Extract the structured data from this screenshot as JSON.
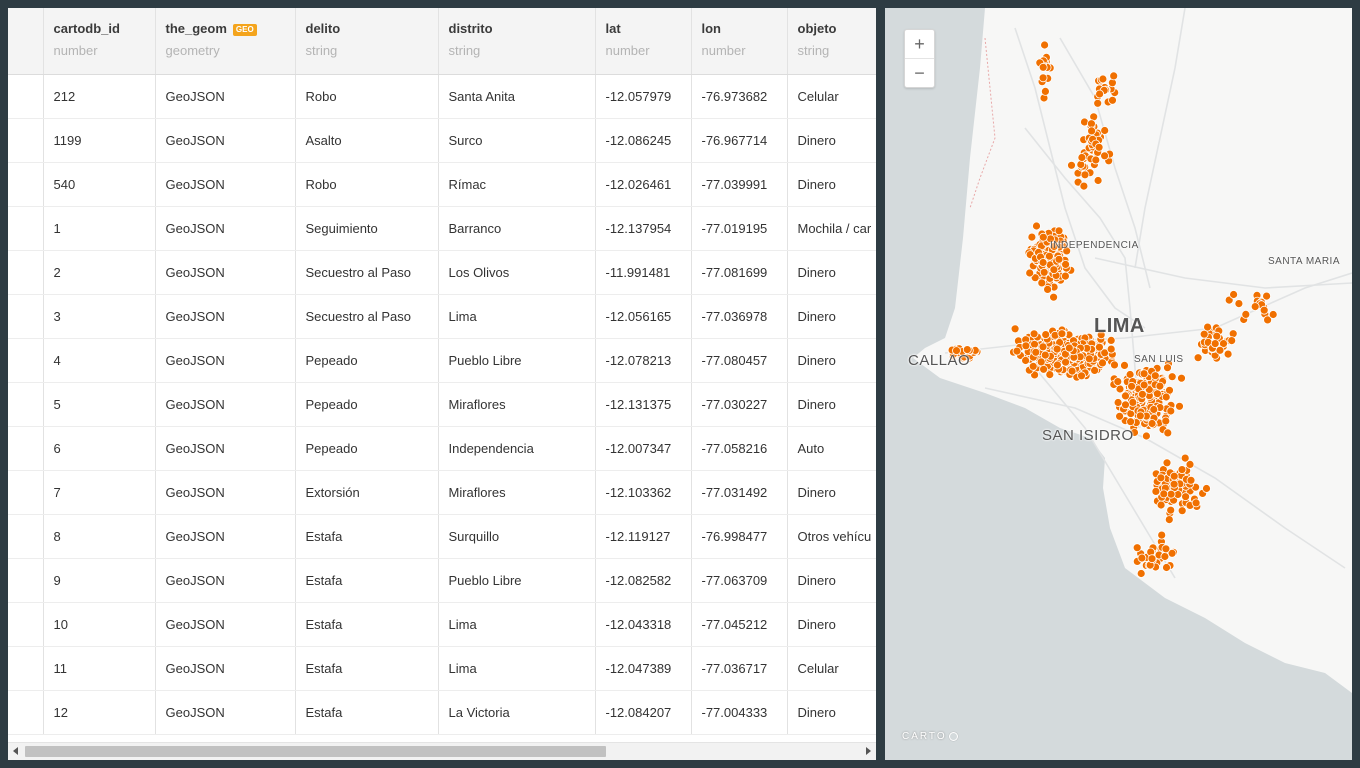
{
  "table": {
    "columns": [
      {
        "name": "cartodb_id",
        "type": "number"
      },
      {
        "name": "the_geom",
        "type": "geometry",
        "badge": "GEO"
      },
      {
        "name": "delito",
        "type": "string"
      },
      {
        "name": "distrito",
        "type": "string"
      },
      {
        "name": "lat",
        "type": "number"
      },
      {
        "name": "lon",
        "type": "number"
      },
      {
        "name": "objeto",
        "type": "string"
      }
    ],
    "rows": [
      {
        "id": "212",
        "geom": "GeoJSON",
        "delito": "Robo",
        "distrito": "Santa Anita",
        "lat": "-12.057979",
        "lon": "-76.973682",
        "objeto": "Celular"
      },
      {
        "id": "1199",
        "geom": "GeoJSON",
        "delito": "Asalto",
        "distrito": "Surco",
        "lat": "-12.086245",
        "lon": "-76.967714",
        "objeto": "Dinero"
      },
      {
        "id": "540",
        "geom": "GeoJSON",
        "delito": "Robo",
        "distrito": "Rímac",
        "lat": "-12.026461",
        "lon": "-77.039991",
        "objeto": "Dinero"
      },
      {
        "id": "1",
        "geom": "GeoJSON",
        "delito": "Seguimiento",
        "distrito": "Barranco",
        "lat": "-12.137954",
        "lon": "-77.019195",
        "objeto": "Mochila / car"
      },
      {
        "id": "2",
        "geom": "GeoJSON",
        "delito": "Secuestro al Paso",
        "distrito": "Los Olivos",
        "lat": "-11.991481",
        "lon": "-77.081699",
        "objeto": "Dinero"
      },
      {
        "id": "3",
        "geom": "GeoJSON",
        "delito": "Secuestro al Paso",
        "distrito": "Lima",
        "lat": "-12.056165",
        "lon": "-77.036978",
        "objeto": "Dinero"
      },
      {
        "id": "4",
        "geom": "GeoJSON",
        "delito": "Pepeado",
        "distrito": "Pueblo Libre",
        "lat": "-12.078213",
        "lon": "-77.080457",
        "objeto": "Dinero"
      },
      {
        "id": "5",
        "geom": "GeoJSON",
        "delito": "Pepeado",
        "distrito": "Miraflores",
        "lat": "-12.131375",
        "lon": "-77.030227",
        "objeto": "Dinero"
      },
      {
        "id": "6",
        "geom": "GeoJSON",
        "delito": "Pepeado",
        "distrito": "Independencia",
        "lat": "-12.007347",
        "lon": "-77.058216",
        "objeto": "Auto"
      },
      {
        "id": "7",
        "geom": "GeoJSON",
        "delito": "Extorsión",
        "distrito": "Miraflores",
        "lat": "-12.103362",
        "lon": "-77.031492",
        "objeto": "Dinero"
      },
      {
        "id": "8",
        "geom": "GeoJSON",
        "delito": "Estafa",
        "distrito": "Surquillo",
        "lat": "-12.119127",
        "lon": "-76.998477",
        "objeto": "Otros vehícu"
      },
      {
        "id": "9",
        "geom": "GeoJSON",
        "delito": "Estafa",
        "distrito": "Pueblo Libre",
        "lat": "-12.082582",
        "lon": "-77.063709",
        "objeto": "Dinero"
      },
      {
        "id": "10",
        "geom": "GeoJSON",
        "delito": "Estafa",
        "distrito": "Lima",
        "lat": "-12.043318",
        "lon": "-77.045212",
        "objeto": "Dinero"
      },
      {
        "id": "11",
        "geom": "GeoJSON",
        "delito": "Estafa",
        "distrito": "Lima",
        "lat": "-12.047389",
        "lon": "-77.036717",
        "objeto": "Celular"
      },
      {
        "id": "12",
        "geom": "GeoJSON",
        "delito": "Estafa",
        "distrito": "La Victoria",
        "lat": "-12.084207",
        "lon": "-77.004333",
        "objeto": "Dinero"
      }
    ]
  },
  "map": {
    "zoom_in": "+",
    "zoom_out": "−",
    "labels": {
      "independencia": "INDEPENDENCIA",
      "santa_maria": "SANTA MARIA",
      "lima": "LIMA",
      "callao": "CALLAO",
      "san_luis": "SAN LUIS",
      "san_isidro": "SAN ISIDRO"
    },
    "attribution": "CARTO",
    "point_color": "#f07000",
    "sea_color": "#d4dadc",
    "land_color": "#f7f7f6"
  },
  "colors": {
    "frame": "#2e3c43",
    "number_text": "#1eae61",
    "geo_badge": "#f4a41c"
  }
}
